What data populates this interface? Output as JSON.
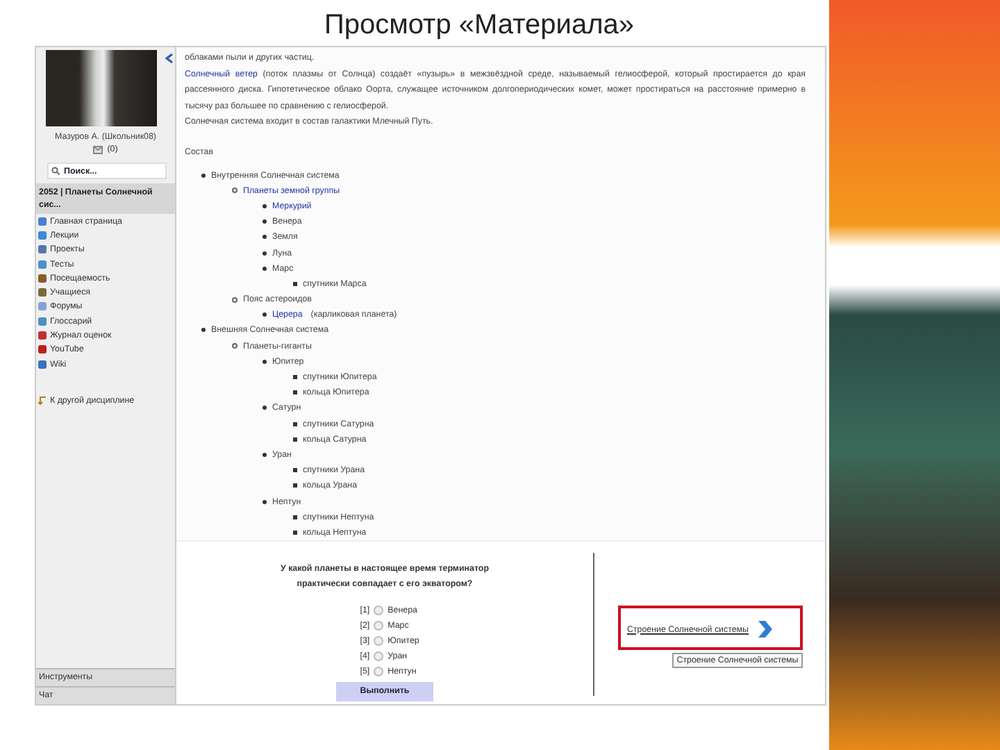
{
  "slide_title": "Просмотр «Материала»",
  "sidebar": {
    "user_name": "Мазуров А. (Школьник08)",
    "messages_count": "(0)",
    "search": {
      "placeholder": "Поиск..."
    },
    "course_title": "2052 | Планеты Солнечной сис...",
    "items": [
      {
        "label": "Главная страница"
      },
      {
        "label": "Лекции"
      },
      {
        "label": "Проекты"
      },
      {
        "label": "Тесты"
      },
      {
        "label": "Посещаемость"
      },
      {
        "label": "Учащиеся"
      },
      {
        "label": "Форумы"
      },
      {
        "label": "Глоссарий"
      },
      {
        "label": "Журнал оценок"
      },
      {
        "label": "YouTube"
      },
      {
        "label": "Wiki"
      }
    ],
    "other_discipline": "К другой дисциплине",
    "tools": "Инструменты",
    "chat": "Чат"
  },
  "article": {
    "paragraphs": [
      {
        "text": "облаками пыли и других частиц."
      },
      {
        "link": "Солнечный ветер",
        "text": " (поток плазмы от Солнца) создаёт «пузырь» в межзвёздной среде, называемый гелиосферой, который простирается до края рассеянного диска. Гипотетическое облако Оорта, служащее источником долгопериодических комет, может простираться на расстояние примерно в тысячу раз большее по сравнению с гелиосферой."
      },
      {
        "text": "Солнечная система входит в состав галактики Млечный Путь."
      }
    ],
    "heading": "Состав",
    "tree": [
      {
        "label": "Внутренняя Солнечная система",
        "link": false,
        "children": [
          {
            "label": "Планеты земной группы",
            "link": true,
            "children": [
              {
                "label": "Меркурий",
                "link": true
              },
              {
                "label": "Венера",
                "link": false
              },
              {
                "label": "Земля",
                "link": false
              },
              {
                "label": "Луна",
                "link": false
              },
              {
                "label": "Марс",
                "link": false,
                "children": [
                  {
                    "label": "спутники Марса",
                    "link": false
                  }
                ]
              }
            ]
          },
          {
            "label": "Пояс астероидов",
            "link": false,
            "children": [
              {
                "label": "Церера",
                "note": "(карликовая планета)",
                "link": true
              }
            ]
          }
        ]
      },
      {
        "label": "Внешняя Солнечная система",
        "link": false,
        "children": [
          {
            "label": "Планеты-гиганты",
            "link": false,
            "children": [
              {
                "label": "Юпитер",
                "link": false,
                "children": [
                  {
                    "label": "спутники Юпитера",
                    "link": false
                  },
                  {
                    "label": "кольца Юпитера",
                    "link": false
                  }
                ]
              },
              {
                "label": "Сатурн",
                "link": false,
                "children": [
                  {
                    "label": "спутники Сатурна",
                    "link": false
                  },
                  {
                    "label": "кольца Сатурна",
                    "link": false
                  }
                ]
              },
              {
                "label": "Уран",
                "link": false,
                "children": [
                  {
                    "label": "спутники Урана",
                    "link": false
                  },
                  {
                    "label": "кольца Урана",
                    "link": false
                  }
                ]
              },
              {
                "label": "Нептун",
                "link": false,
                "children": [
                  {
                    "label": "спутники Нептуна",
                    "link": false
                  },
                  {
                    "label": "кольца Нептуна",
                    "link": false
                  }
                ]
              }
            ]
          }
        ]
      }
    ]
  },
  "quiz": {
    "question": "У какой планеты в настоящее время терминатор практически совпадает с его экватором?",
    "options": [
      {
        "number": "[1]",
        "label": "Венера",
        "selected": false
      },
      {
        "number": "[2]",
        "label": "Марс",
        "selected": false
      },
      {
        "number": "[3]",
        "label": "Юпитер",
        "selected": false
      },
      {
        "number": "[4]",
        "label": "Уран",
        "selected": false
      },
      {
        "number": "[5]",
        "label": "Нептун",
        "selected": false
      }
    ],
    "submit": "Выполнить"
  },
  "next_link": {
    "label": "Строение Солнечной системы",
    "tooltip": "Строение Солнечной системы"
  }
}
